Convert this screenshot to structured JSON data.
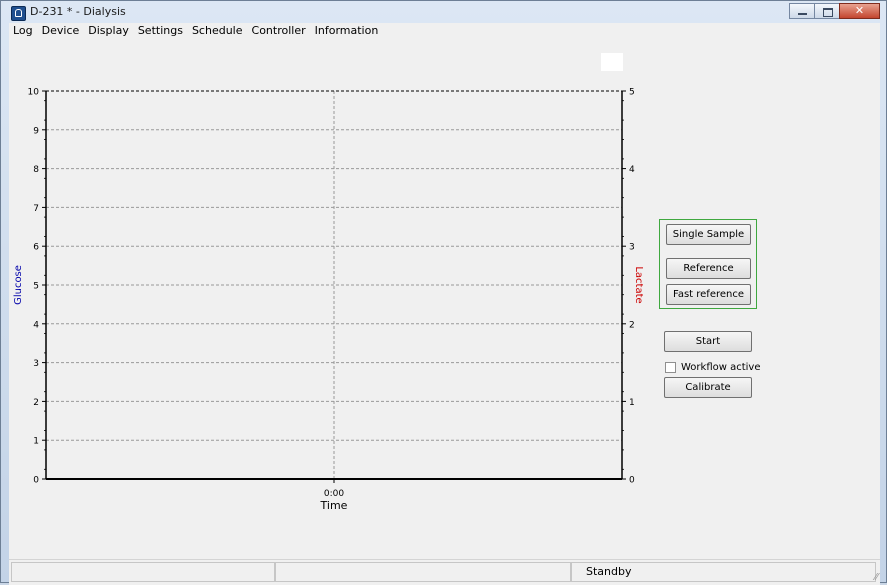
{
  "window": {
    "title": "D-231 * - Dialysis"
  },
  "menu": [
    "Log",
    "Device",
    "Display",
    "Settings",
    "Schedule",
    "Controller",
    "Information"
  ],
  "chart_data": {
    "type": "line",
    "xlabel": "Time",
    "x_ticks": [
      "0:00"
    ],
    "ylabel_left": "Glucose",
    "ylabel_right": "Lactate",
    "ylim_left": [
      0,
      10
    ],
    "ylim_right": [
      0,
      5
    ],
    "y_ticks_left": [
      "0",
      "1",
      "2",
      "3",
      "4",
      "5",
      "6",
      "7",
      "8",
      "9",
      "10"
    ],
    "y_ticks_right": [
      "0",
      "1",
      "2",
      "3",
      "4",
      "5"
    ],
    "grid": true,
    "series": [],
    "colors": {
      "glucose": "#0000aa",
      "lactate": "#cc0000",
      "grid": "#999999"
    }
  },
  "buttons": {
    "single_sample": "Single Sample",
    "reference": "Reference",
    "fast_reference": "Fast reference",
    "start": "Start",
    "calibrate": "Calibrate"
  },
  "workflow": {
    "label": "Workflow active",
    "checked": false
  },
  "status": {
    "panes": [
      "",
      "",
      "Standby"
    ]
  }
}
